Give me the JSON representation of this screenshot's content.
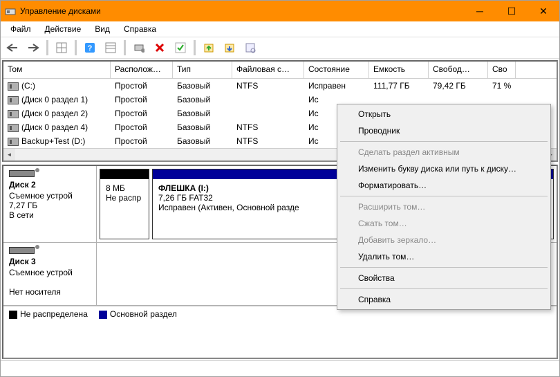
{
  "title": "Управление дисками",
  "menu": {
    "file": "Файл",
    "action": "Действие",
    "view": "Вид",
    "help": "Справка"
  },
  "columns": [
    "Том",
    "Располож…",
    "Тип",
    "Файловая с…",
    "Состояние",
    "Емкость",
    "Свобод…",
    "Сво"
  ],
  "rows": [
    {
      "name": "(C:)",
      "layout": "Простой",
      "type": "Базовый",
      "fs": "NTFS",
      "state": "Исправен",
      "cap": "111,77 ГБ",
      "free": "79,42 ГБ",
      "pct": "71 %"
    },
    {
      "name": "(Диск 0 раздел 1)",
      "layout": "Простой",
      "type": "Базовый",
      "fs": "",
      "state": "Ис",
      "cap": "",
      "free": "",
      "pct": ""
    },
    {
      "name": "(Диск 0 раздел 2)",
      "layout": "Простой",
      "type": "Базовый",
      "fs": "",
      "state": "Ис",
      "cap": "",
      "free": "",
      "pct": ""
    },
    {
      "name": "(Диск 0 раздел 4)",
      "layout": "Простой",
      "type": "Базовый",
      "fs": "NTFS",
      "state": "Ис",
      "cap": "",
      "free": "",
      "pct": ""
    },
    {
      "name": "Backup+Test (D:)",
      "layout": "Простой",
      "type": "Базовый",
      "fs": "NTFS",
      "state": "Ис",
      "cap": "",
      "free": "",
      "pct": ""
    }
  ],
  "disk2": {
    "name": "Диск 2",
    "type": "Съемное устрой",
    "size": "7,27 ГБ",
    "status": "В сети",
    "part_unalloc": {
      "size": "8 МБ",
      "state": "Не распр"
    },
    "part_main": {
      "title": "ФЛЕШКА  (I:)",
      "sub": "7,26 ГБ FAT32",
      "state": "Исправен (Активен, Основной разде"
    }
  },
  "disk3": {
    "name": "Диск 3",
    "type": "Съемное устрой",
    "status": "Нет носителя"
  },
  "legend": {
    "unalloc": "Не распределена",
    "primary": "Основной раздел"
  },
  "ctx": {
    "open": "Открыть",
    "explorer": "Проводник",
    "active": "Сделать раздел активным",
    "letter": "Изменить букву диска или путь к диску…",
    "format": "Форматировать…",
    "extend": "Расширить том…",
    "shrink": "Сжать том…",
    "mirror": "Добавить зеркало…",
    "delete": "Удалить том…",
    "props": "Свойства",
    "help": "Справка"
  }
}
